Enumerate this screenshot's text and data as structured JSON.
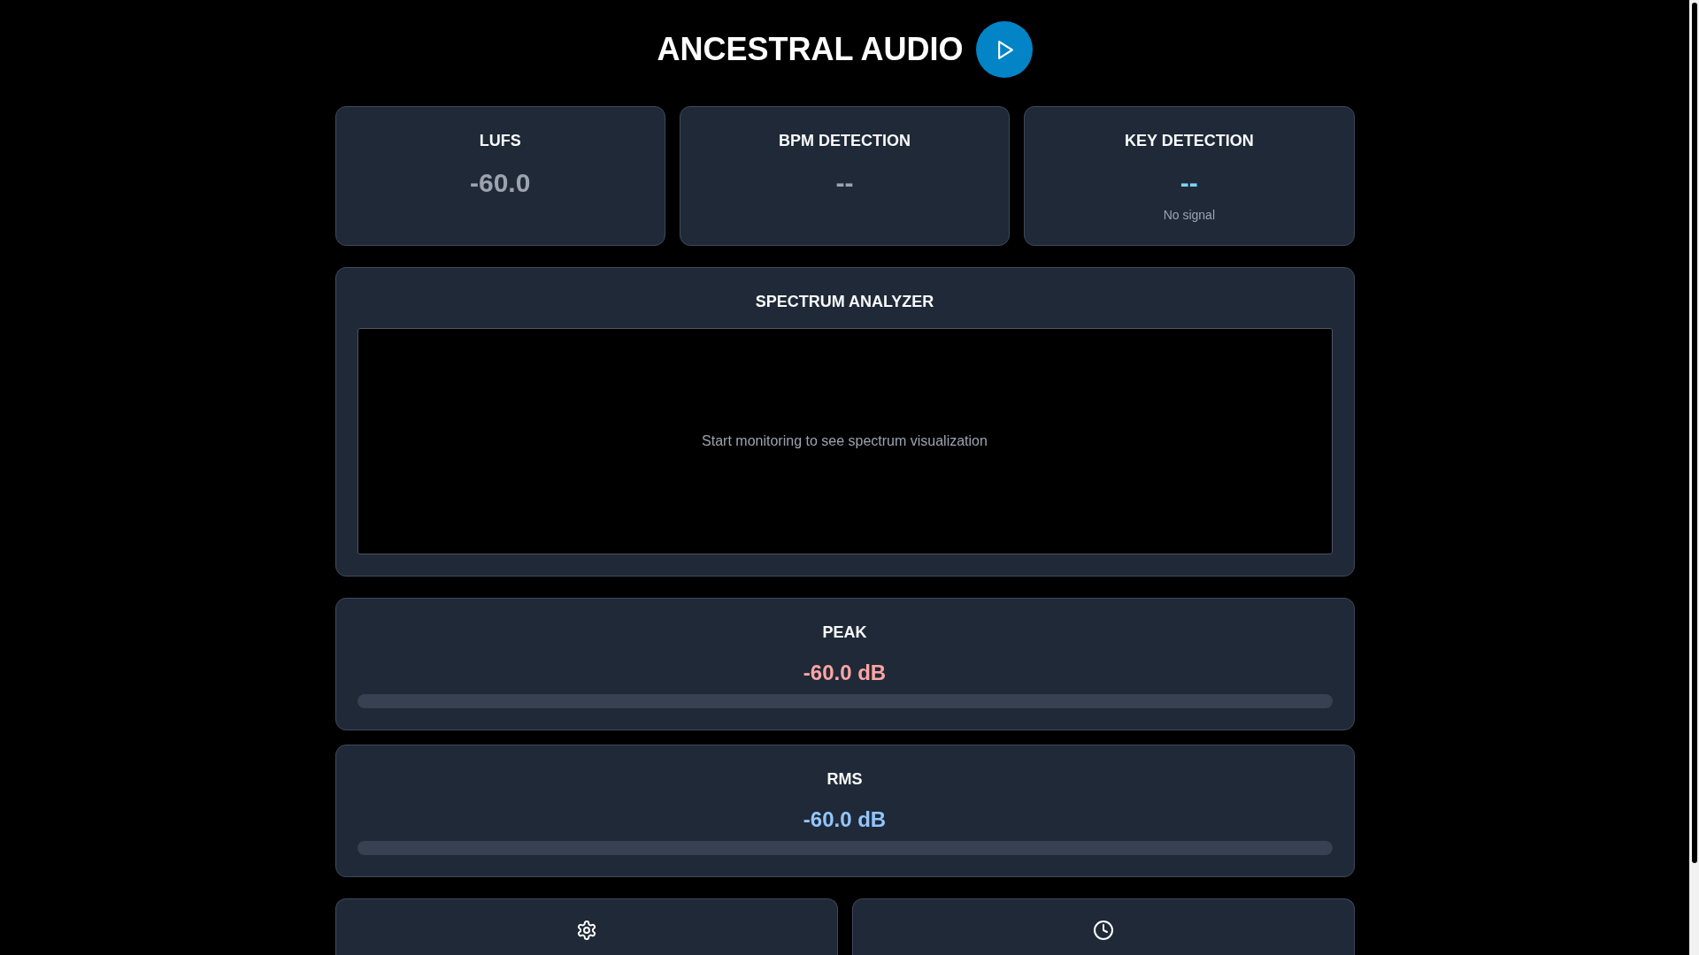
{
  "header": {
    "title": "ANCESTRAL AUDIO",
    "play_button": {
      "playing": false
    }
  },
  "stats": [
    {
      "title": "LUFS",
      "value": "-60.0",
      "color": "#9ca3af"
    },
    {
      "title": "BPM DETECTION",
      "value": "--",
      "color": "#9ca3af"
    },
    {
      "title": "KEY DETECTION",
      "value": "--",
      "color": "#7dd3fc",
      "note": "No signal"
    }
  ],
  "spectrum": {
    "title": "SPECTRUM ANALYZER",
    "message": "Start monitoring to see spectrum visualization"
  },
  "meters": [
    {
      "title": "PEAK",
      "reading": "-60.0 dB",
      "color": "#fca5a5"
    },
    {
      "title": "RMS",
      "reading": "-60.0 dB",
      "color": "#93c5fd"
    }
  ],
  "panels": [
    {
      "kind": "settings"
    },
    {
      "kind": "clock"
    }
  ]
}
